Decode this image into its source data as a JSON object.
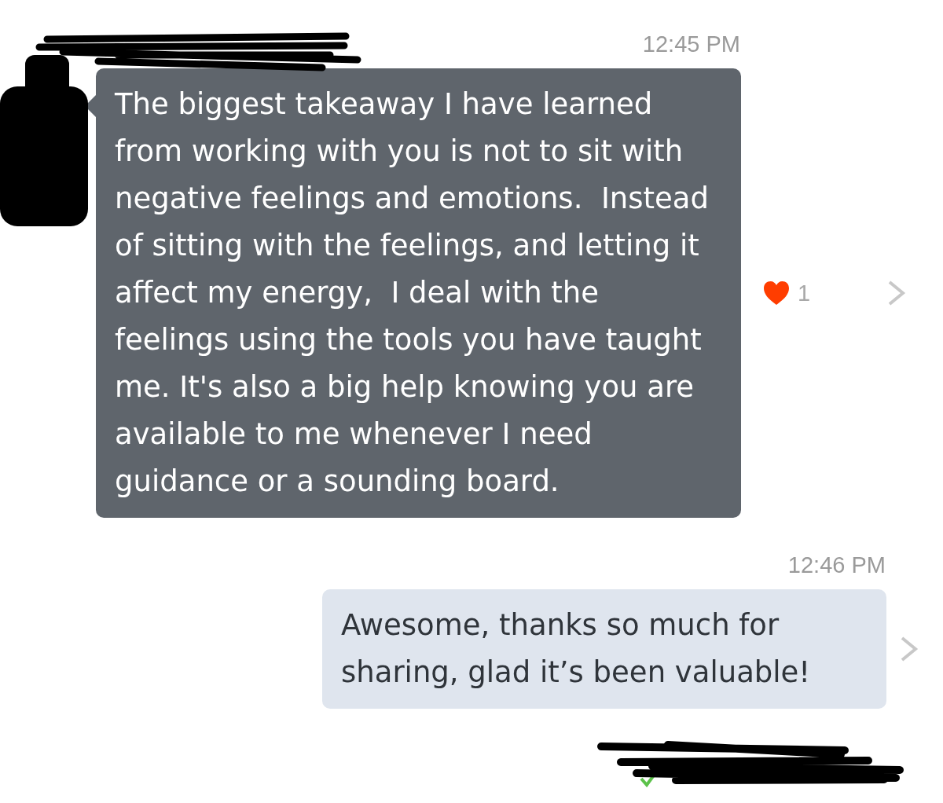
{
  "messages": [
    {
      "kind": "incoming",
      "time": "12:45 PM",
      "text": "The biggest takeaway I have learned from working with you is not to sit with negative feelings and emotions.  Instead of sitting with the feelings, and letting it affect my energy,  I deal with the feelings using the tools you have taught me. It's also a big help knowing you are available to me whenever I need guidance or a sounding board.",
      "reaction": {
        "count": "1",
        "color": "#ff3d00"
      }
    },
    {
      "kind": "outgoing",
      "time": "12:46 PM",
      "text": "Awesome, thanks so much for sharing, glad it’s been valuable!",
      "delivered": true
    }
  ]
}
